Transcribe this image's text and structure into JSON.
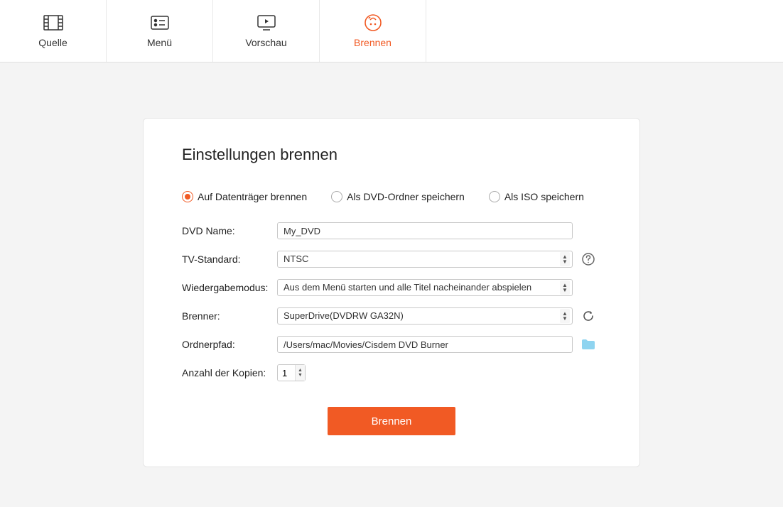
{
  "tabs": {
    "source": "Quelle",
    "menu": "Menü",
    "preview": "Vorschau",
    "burn": "Brennen",
    "activeIndex": 3
  },
  "panel": {
    "title": "Einstellungen brennen",
    "outputOptions": {
      "toDisc": "Auf Datenträger brennen",
      "asFolder": "Als DVD-Ordner speichern",
      "asISO": "Als ISO speichern",
      "selected": "toDisc"
    },
    "labels": {
      "dvdName": "DVD Name:",
      "tvStandard": "TV-Standard:",
      "playbackMode": "Wiedergabemodus:",
      "burner": "Brenner:",
      "folderPath": "Ordnerpfad:",
      "copies": "Anzahl der Kopien:"
    },
    "values": {
      "dvdName": "My_DVD",
      "tvStandard": "NTSC",
      "playbackMode": "Aus dem Menü starten und alle Titel nacheinander abspielen",
      "burner": "SuperDrive(DVDRW  GA32N)",
      "folderPath": "/Users/mac/Movies/Cisdem DVD Burner",
      "copies": "1"
    },
    "burnButton": "Brennen"
  }
}
